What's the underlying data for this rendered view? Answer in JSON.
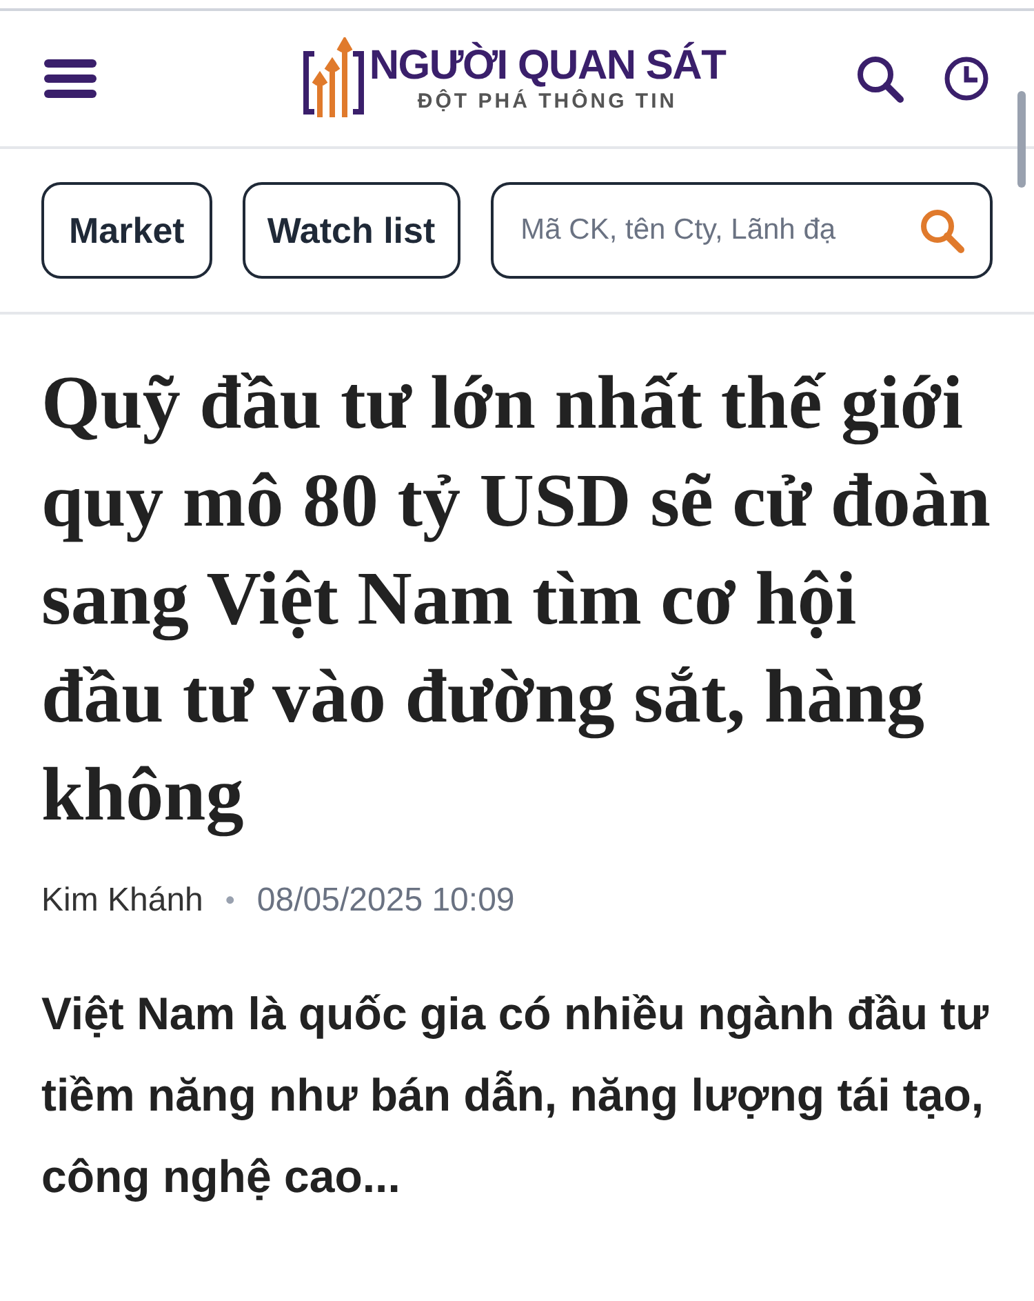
{
  "header": {
    "logo_title": "NGƯỜI QUAN SÁT",
    "logo_tagline": "ĐỘT PHÁ THÔNG TIN"
  },
  "toolbar": {
    "buttons": [
      "Market",
      "Watch list"
    ],
    "search": {
      "placeholder": "Mã CK, tên Cty, Lãnh đạ"
    }
  },
  "article": {
    "title": "Quỹ đầu tư lớn nhất thế giới quy mô 80 tỷ USD sẽ cử đoàn sang Việt Nam tìm cơ hội đầu tư vào đường sắt, hàng không",
    "author": "Kim Khánh",
    "separator": "•",
    "date": "08/05/2025 10:09",
    "summary": "Việt Nam là quốc gia có nhiều ngành đầu tư tiềm năng như bán dẫn, năng lượng tái tạo, công nghệ cao..."
  }
}
